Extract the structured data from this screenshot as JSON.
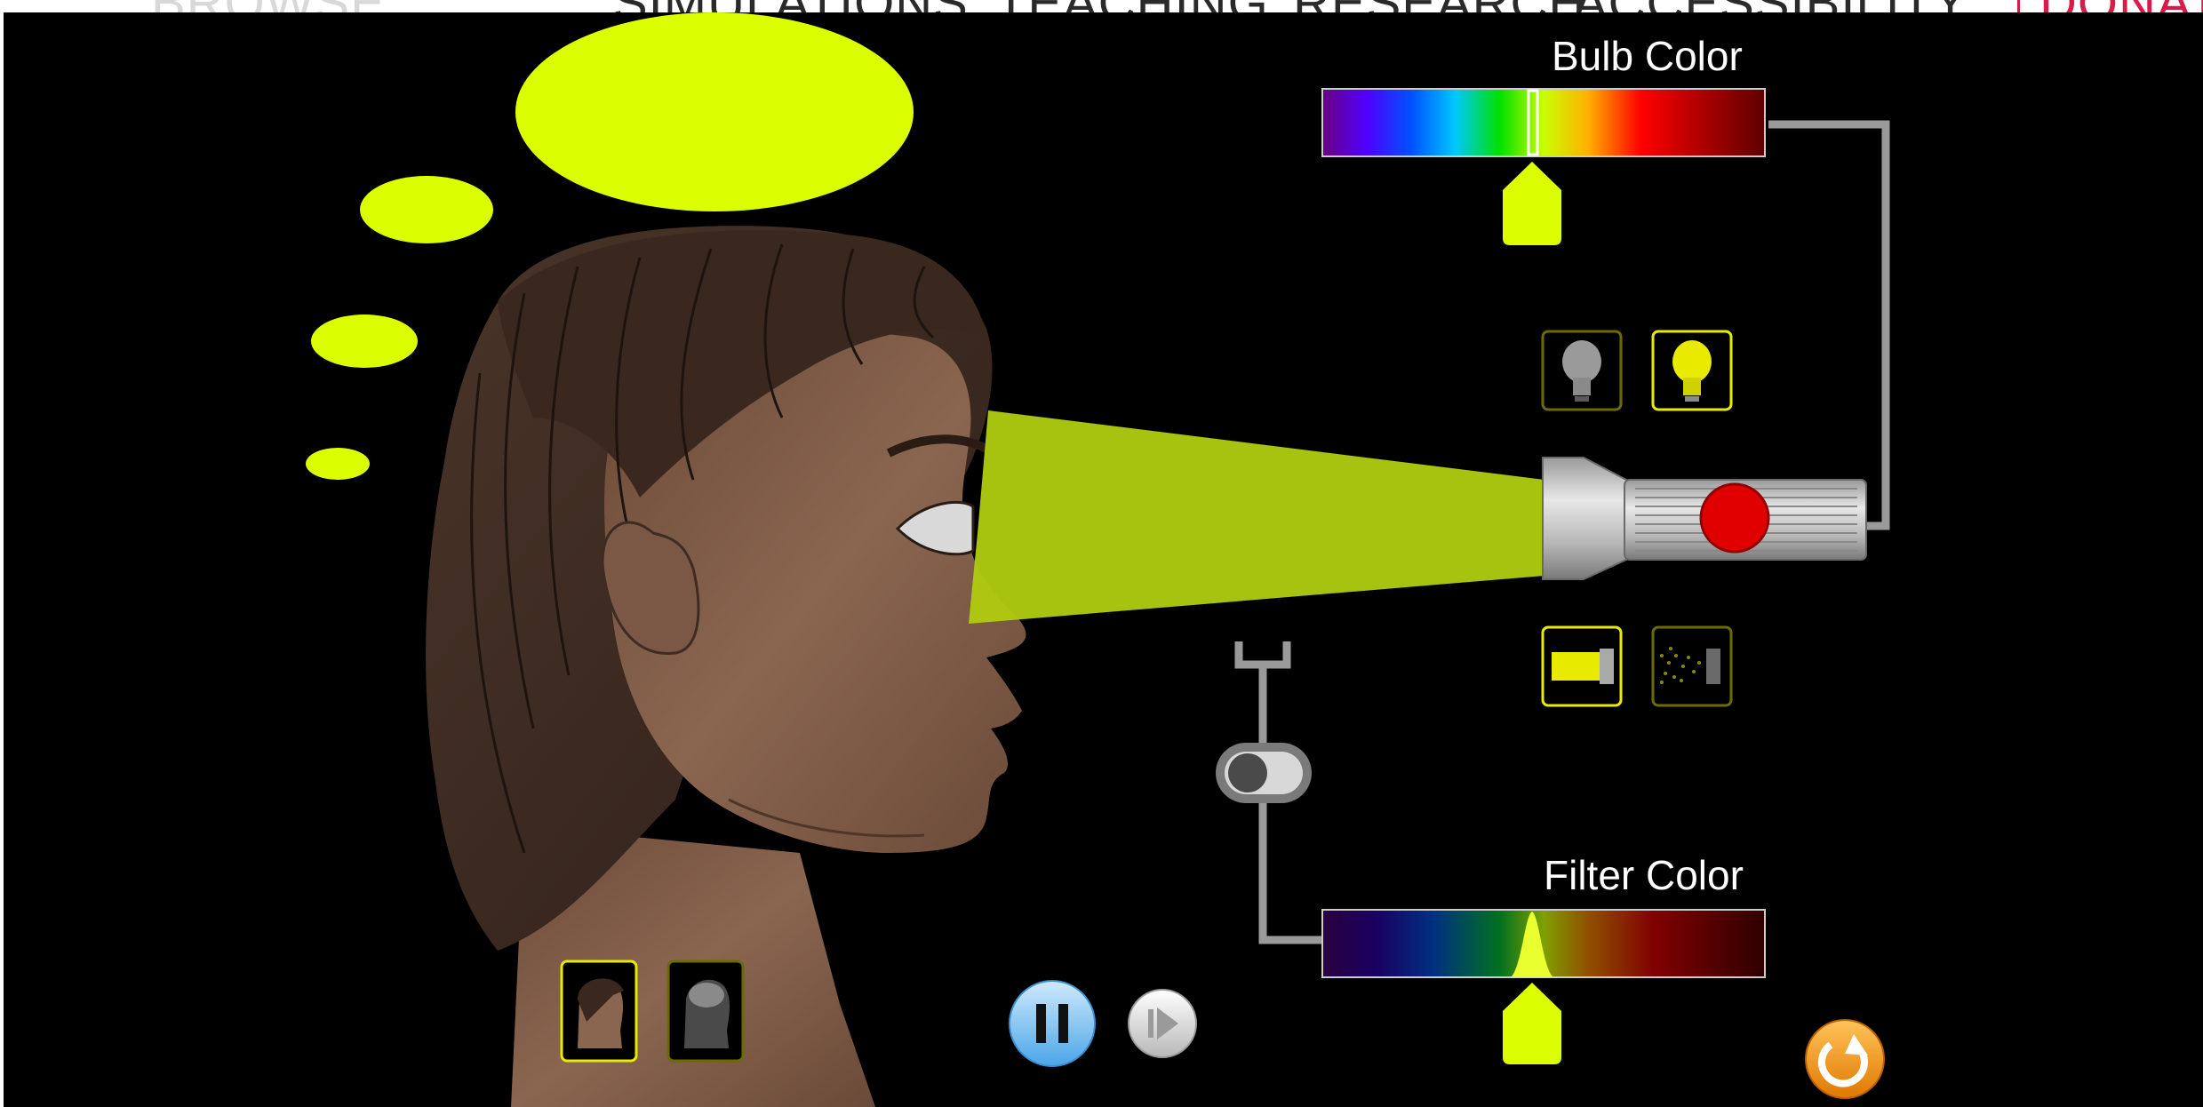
{
  "site_nav": {
    "items": [
      {
        "label": "SIMULATIONS"
      },
      {
        "label": "TEACHING"
      },
      {
        "label": "RESEARCH"
      },
      {
        "label": "ACCESSIBILITY"
      },
      {
        "label": "DONATE"
      }
    ]
  },
  "sim": {
    "bulb_color_label": "Bulb Color",
    "filter_color_label": "Filter Color",
    "bulb_color_value": 0.47,
    "filter_color_value": 0.47,
    "perceived_color": "#dcff00",
    "beam_color": "#b0cc10",
    "filter_enabled": false,
    "light_mode": "beam",
    "bulb_type": "colored",
    "view": "head",
    "playing": true
  },
  "colors": {
    "background": "#000000",
    "yellow_accent": "#e8ea00",
    "reset_orange": "#f39a1e",
    "play_blue": "#7cc3f3",
    "flashlight_button_red": "#e00000"
  }
}
